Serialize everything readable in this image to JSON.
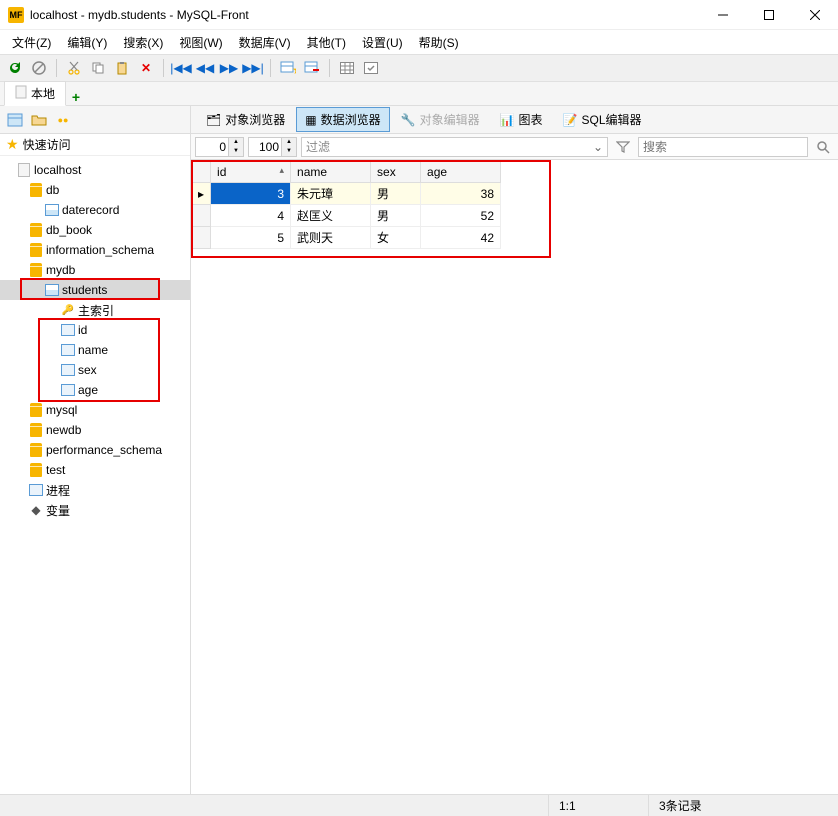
{
  "window": {
    "title": "localhost - mydb.students - MySQL-Front",
    "logo_text": "MF"
  },
  "menu": [
    "文件(Z)",
    "编辑(Y)",
    "搜索(X)",
    "视图(W)",
    "数据库(V)",
    "其他(T)",
    "设置(U)",
    "帮助(S)"
  ],
  "tabs": {
    "local": "本地"
  },
  "quick_access": "快速访问",
  "tree": {
    "host": "localhost",
    "dbs": [
      {
        "name": "db",
        "children": [
          {
            "name": "daterecord",
            "type": "table"
          }
        ]
      },
      {
        "name": "db_book"
      },
      {
        "name": "information_schema"
      },
      {
        "name": "mydb",
        "children": [
          {
            "name": "students",
            "type": "table",
            "selected": true,
            "children": [
              {
                "name": "主索引",
                "type": "key"
              },
              {
                "name": "id",
                "type": "col"
              },
              {
                "name": "name",
                "type": "col"
              },
              {
                "name": "sex",
                "type": "col"
              },
              {
                "name": "age",
                "type": "col"
              }
            ]
          }
        ]
      },
      {
        "name": "mysql"
      },
      {
        "name": "newdb"
      },
      {
        "name": "performance_schema"
      },
      {
        "name": "test"
      }
    ],
    "processes": "进程",
    "variables": "变量"
  },
  "viewtabs": {
    "object_browser": "对象浏览器",
    "data_browser": "数据浏览器",
    "object_editor": "对象编辑器",
    "chart": "图表",
    "sql_editor": "SQL编辑器"
  },
  "filterbar": {
    "offset": "0",
    "limit": "100",
    "filter_placeholder": "过滤",
    "search_placeholder": "搜索"
  },
  "grid": {
    "columns": [
      "id",
      "name",
      "sex",
      "age"
    ],
    "rows": [
      {
        "id": 3,
        "name": "朱元璋",
        "sex": "男",
        "age": 38,
        "selected": true
      },
      {
        "id": 4,
        "name": "赵匡义",
        "sex": "男",
        "age": 52
      },
      {
        "id": 5,
        "name": "武则天",
        "sex": "女",
        "age": 42
      }
    ]
  },
  "status": {
    "pos": "1:1",
    "count": "3条记录"
  }
}
